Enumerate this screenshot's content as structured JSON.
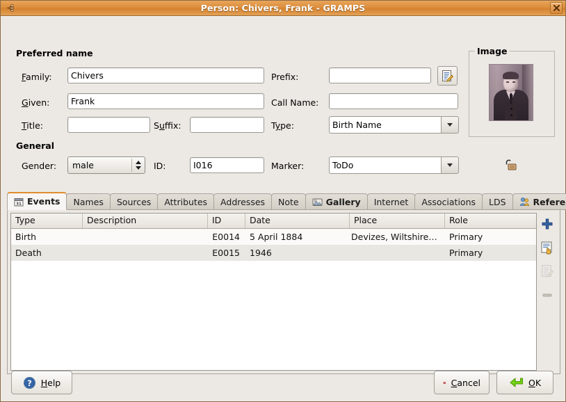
{
  "window": {
    "title": "Person: Chivers, Frank - GRAMPS",
    "close_tooltip": "Close"
  },
  "sections": {
    "preferred_name": "Preferred name",
    "general": "General"
  },
  "fields": {
    "family": {
      "label": "Family:",
      "mnemonic": "F",
      "value": "Chivers"
    },
    "given": {
      "label": "Given:",
      "mnemonic": "G",
      "value": "Frank"
    },
    "title": {
      "label": "Title:",
      "mnemonic": "T",
      "value": ""
    },
    "suffix": {
      "label": "Suffix:",
      "mnemonic": "u",
      "value": ""
    },
    "prefix": {
      "label": "Prefix:",
      "value": ""
    },
    "call_name": {
      "label": "Call Name:",
      "value": ""
    },
    "type": {
      "label": "Type:",
      "mnemonic": "y",
      "value": "Birth Name"
    },
    "gender": {
      "label": "Gender:",
      "value": "male"
    },
    "id": {
      "label": "ID:",
      "value": "I016"
    },
    "marker": {
      "label": "Marker:",
      "value": "ToDo"
    }
  },
  "image_frame": {
    "label": "Image"
  },
  "tabs": [
    {
      "label": "Events",
      "active": true,
      "bold": true,
      "icon": "calendar-icon"
    },
    {
      "label": "Names",
      "active": false,
      "bold": false,
      "icon": ""
    },
    {
      "label": "Sources",
      "active": false,
      "bold": false,
      "icon": ""
    },
    {
      "label": "Attributes",
      "active": false,
      "bold": false,
      "icon": ""
    },
    {
      "label": "Addresses",
      "active": false,
      "bold": false,
      "icon": ""
    },
    {
      "label": "Note",
      "active": false,
      "bold": false,
      "icon": ""
    },
    {
      "label": "Gallery",
      "active": false,
      "bold": true,
      "icon": "gallery-icon"
    },
    {
      "label": "Internet",
      "active": false,
      "bold": false,
      "icon": ""
    },
    {
      "label": "Associations",
      "active": false,
      "bold": false,
      "icon": ""
    },
    {
      "label": "LDS",
      "active": false,
      "bold": false,
      "icon": ""
    },
    {
      "label": "References",
      "active": false,
      "bold": true,
      "icon": "references-icon"
    }
  ],
  "events_table": {
    "columns": [
      "Type",
      "Description",
      "ID",
      "Date",
      "Place",
      "Role"
    ],
    "rows": [
      {
        "Type": "Birth",
        "Description": "",
        "ID": "E0014",
        "Date": "5 April 1884",
        "Place": "Devizes, Wiltshire, …",
        "Role": "Primary"
      },
      {
        "Type": "Death",
        "Description": "",
        "ID": "E0015",
        "Date": "1946",
        "Place": "",
        "Role": "Primary"
      }
    ]
  },
  "list_tools": [
    {
      "name": "add-event-button",
      "icon": "plus-icon",
      "enabled": true
    },
    {
      "name": "share-event-button",
      "icon": "share-document-icon",
      "enabled": true
    },
    {
      "name": "edit-event-button",
      "icon": "edit-document-icon",
      "enabled": false
    },
    {
      "name": "remove-event-button",
      "icon": "minus-icon",
      "enabled": false
    }
  ],
  "buttons": {
    "help": {
      "label": "Help",
      "mnemonic": "H",
      "icon": "help-icon"
    },
    "cancel": {
      "label": "Cancel",
      "mnemonic": "C",
      "icon": "cancel-icon"
    },
    "ok": {
      "label": "OK",
      "mnemonic": "O",
      "icon": "ok-icon"
    }
  },
  "colors": {
    "titlebar_accent": "#dd8f3e",
    "active_tab_accent": "#e08c2e",
    "window_bg": "#ece9e4",
    "add_icon": "#3465a4",
    "cancel_icon": "#cc0000",
    "ok_icon": "#73d216"
  }
}
